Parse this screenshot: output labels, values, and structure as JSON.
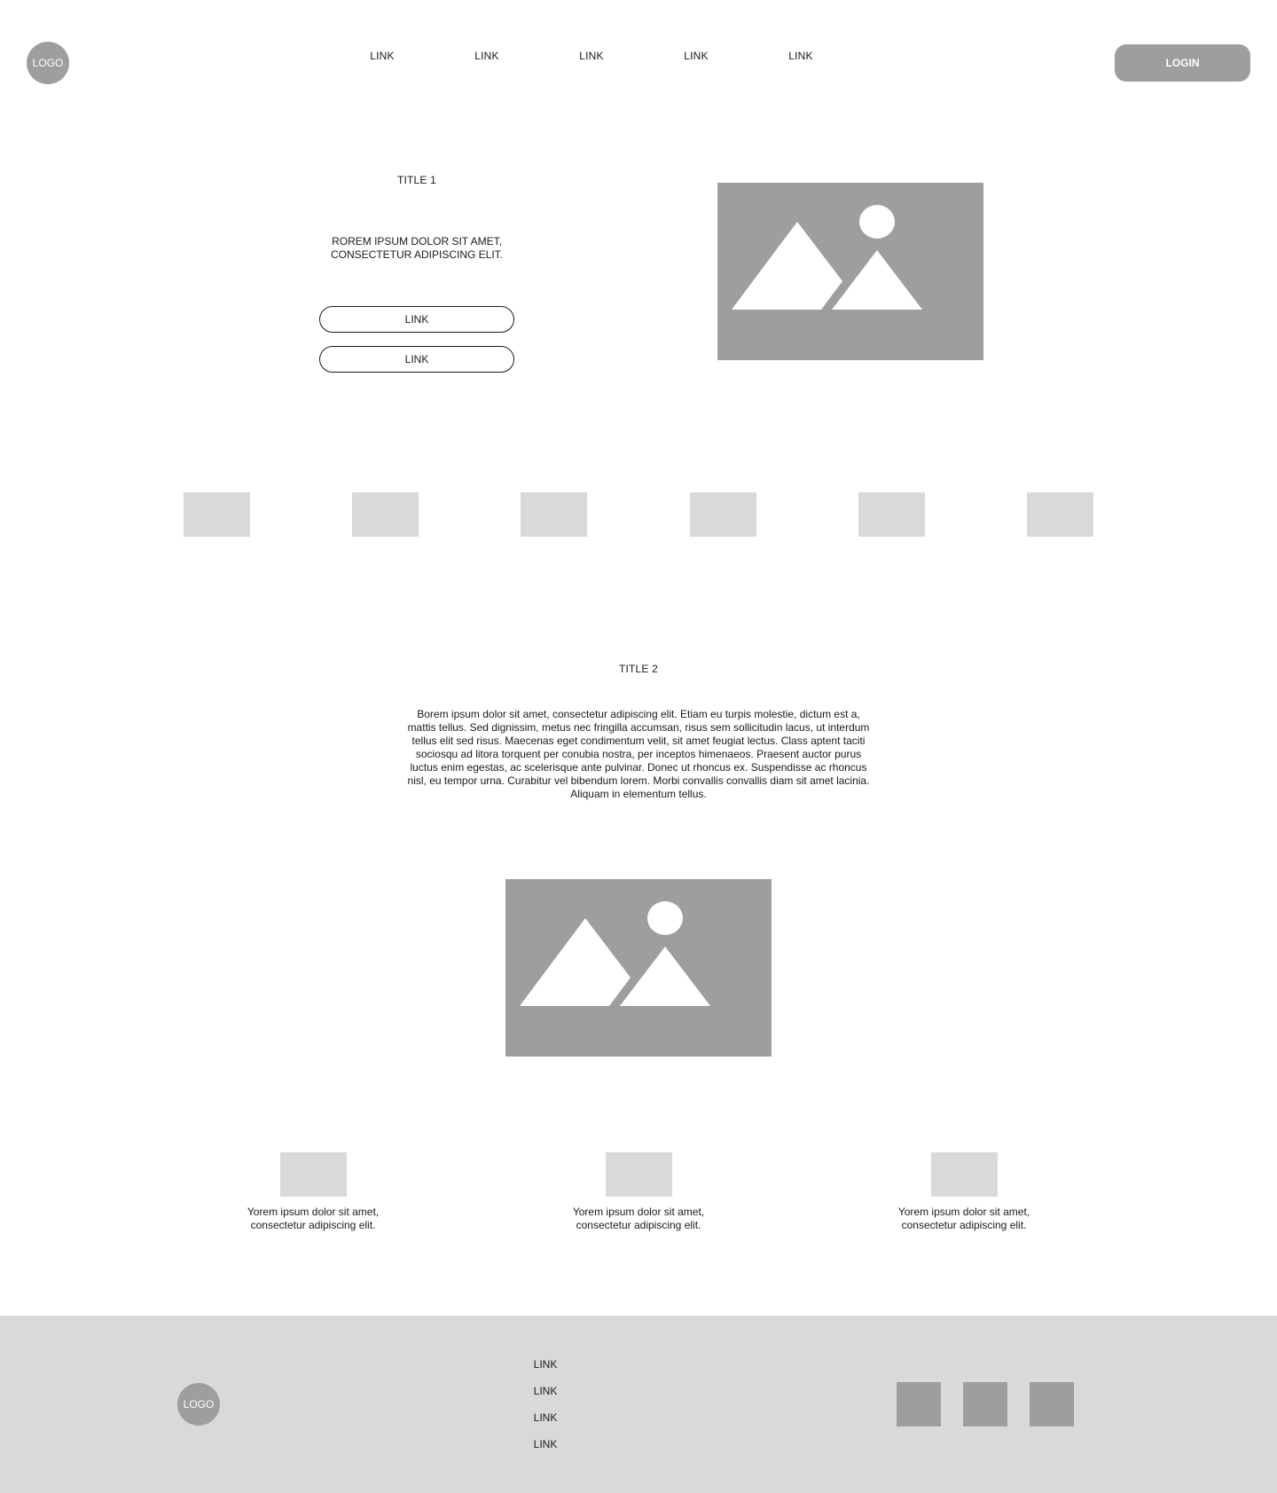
{
  "header": {
    "logo": "LOGO",
    "nav": [
      "LINK",
      "LINK",
      "LINK",
      "LINK",
      "LINK"
    ],
    "login": "LOGIN"
  },
  "hero": {
    "title": "TITLE 1",
    "text": "ROREM IPSUM DOLOR SIT AMET, CONSECTETUR ADIPISCING ELIT.",
    "buttons": [
      "LINK",
      "LINK"
    ],
    "image_icon": "image-placeholder-icon"
  },
  "logo_strip": {
    "count": 6
  },
  "section2": {
    "title": "TITLE 2",
    "body": "Borem ipsum dolor sit amet, consectetur adipiscing elit. Etiam eu turpis molestie, dictum est a, mattis tellus. Sed dignissim, metus nec fringilla accumsan, risus sem sollicitudin lacus, ut interdum tellus elit sed risus. Maecenas eget condimentum velit, sit amet feugiat lectus. Class aptent taciti sociosqu ad litora torquent per conubia nostra, per inceptos himenaeos. Praesent auctor purus luctus enim egestas, ac scelerisque ante pulvinar. Donec ut rhoncus ex. Suspendisse ac rhoncus nisl, eu tempor urna. Curabitur vel bibendum lorem. Morbi convallis convallis diam sit amet lacinia. Aliquam in elementum tellus.",
    "image_icon": "image-placeholder-icon"
  },
  "features": [
    {
      "text": "Yorem ipsum dolor sit amet, consectetur adipiscing elit."
    },
    {
      "text": "Yorem ipsum dolor sit amet, consectetur adipiscing elit."
    },
    {
      "text": "Yorem ipsum dolor sit amet, consectetur adipiscing elit."
    }
  ],
  "footer": {
    "logo": "LOGO",
    "links": [
      "LINK",
      "LINK",
      "LINK",
      "LINK"
    ],
    "social_count": 3
  },
  "colors": {
    "placeholder_dark": "#9e9e9e",
    "placeholder_light": "#d9d9d9",
    "text": "#1a1a1a"
  }
}
